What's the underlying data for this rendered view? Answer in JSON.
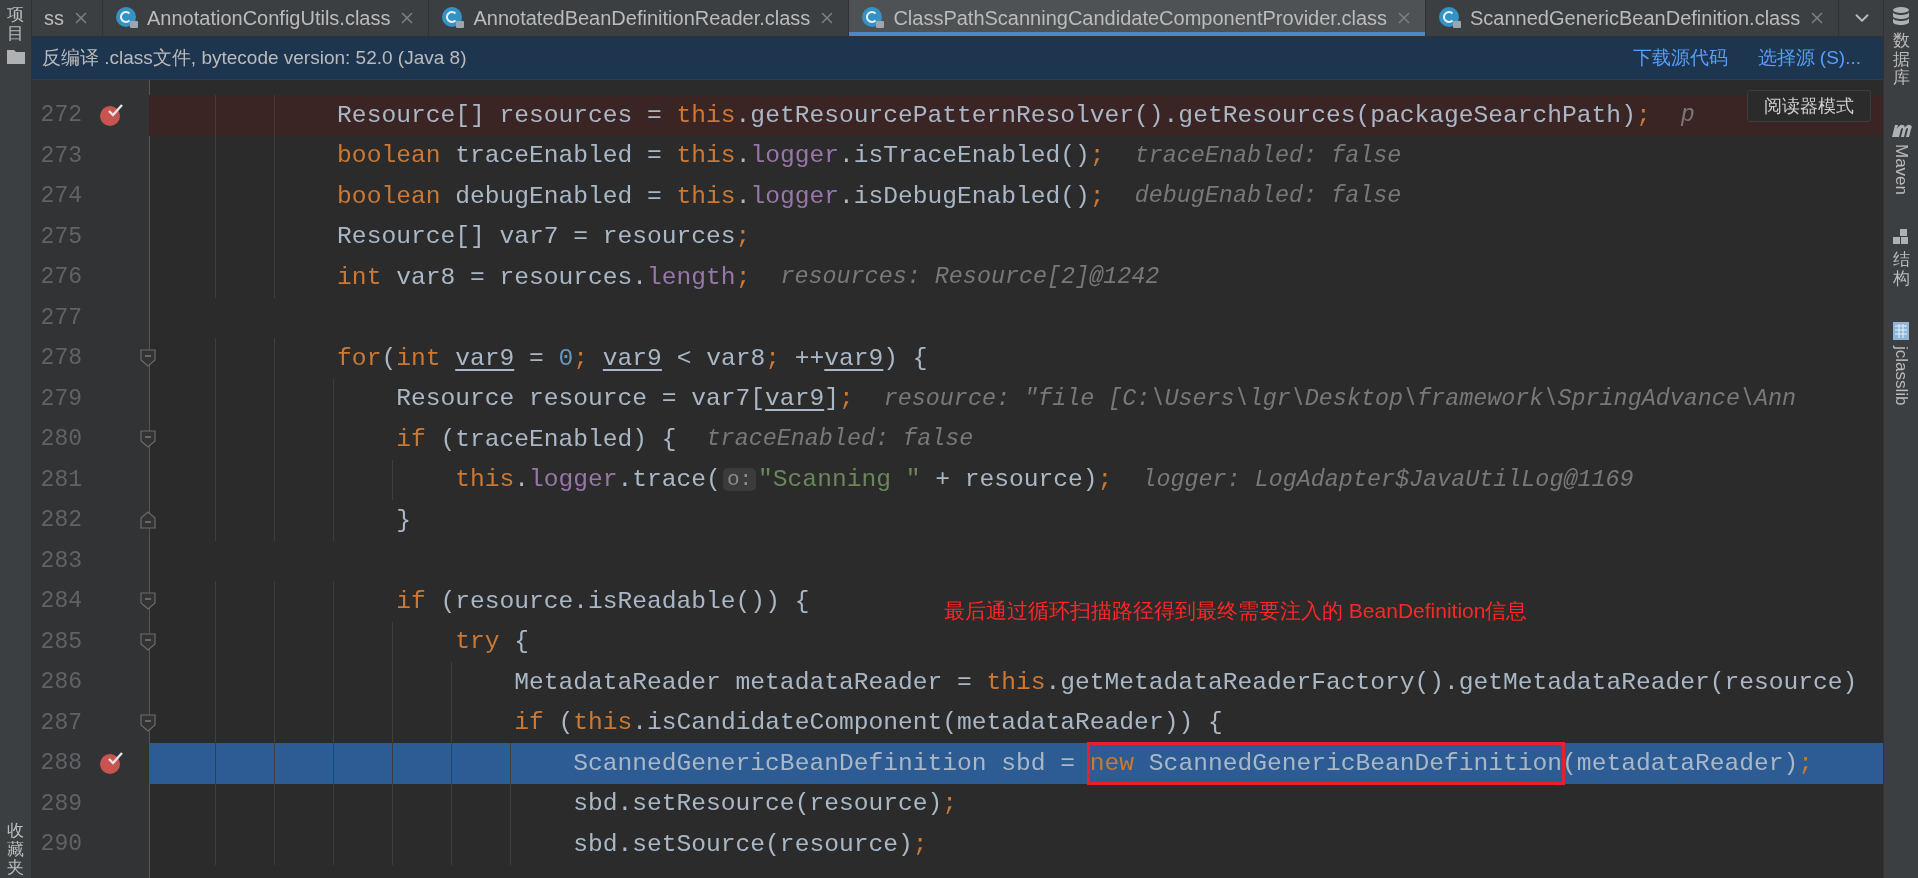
{
  "left_strip": {
    "top_label": "项目",
    "bottom_label": "收藏夹"
  },
  "tabs": [
    {
      "label": "ss",
      "icon": false,
      "selected": false
    },
    {
      "label": "AnnotationConfigUtils.class",
      "icon": true,
      "selected": false
    },
    {
      "label": "AnnotatedBeanDefinitionReader.class",
      "icon": true,
      "selected": false
    },
    {
      "label": "ClassPathScanningCandidateComponentProvider.class",
      "icon": true,
      "selected": true
    },
    {
      "label": "ScannedGenericBeanDefinition.class",
      "icon": true,
      "selected": false
    }
  ],
  "info_bar": {
    "message": "反编译 .class文件, bytecode version: 52.0 (Java 8)",
    "links": [
      "下载源代码",
      "选择源 (S)..."
    ]
  },
  "reader_mode_button": "阅读器模式",
  "lines": [
    {
      "number": "272",
      "breakpoint": true,
      "current": false,
      "tokens": [
        {
          "text": "            Resource[] resources = ",
          "kind": "plain"
        },
        {
          "text": "this",
          "kind": "kw"
        },
        {
          "text": ".getResourcePatternResolver().getResources(packageSearchPath)",
          "kind": "plain"
        },
        {
          "text": ";",
          "kind": "punct"
        }
      ],
      "hint": "p"
    },
    {
      "number": "273",
      "breakpoint": false,
      "current": false,
      "tokens": [
        {
          "text": "            boolean",
          "kind": "kw"
        },
        {
          "text": " traceEnabled = ",
          "kind": "plain"
        },
        {
          "text": "this",
          "kind": "kw"
        },
        {
          "text": ".",
          "kind": "plain"
        },
        {
          "text": "logger",
          "kind": "field"
        },
        {
          "text": ".isTraceEnabled()",
          "kind": "plain"
        },
        {
          "text": ";",
          "kind": "punct"
        }
      ],
      "hint": "traceEnabled: false"
    },
    {
      "number": "274",
      "breakpoint": false,
      "current": false,
      "tokens": [
        {
          "text": "            boolean",
          "kind": "kw"
        },
        {
          "text": " debugEnabled = ",
          "kind": "plain"
        },
        {
          "text": "this",
          "kind": "kw"
        },
        {
          "text": ".",
          "kind": "plain"
        },
        {
          "text": "logger",
          "kind": "field"
        },
        {
          "text": ".isDebugEnabled()",
          "kind": "plain"
        },
        {
          "text": ";",
          "kind": "punct"
        }
      ],
      "hint": "debugEnabled: false"
    },
    {
      "number": "275",
      "breakpoint": false,
      "current": false,
      "tokens": [
        {
          "text": "            Resource[] var7 = resources",
          "kind": "plain"
        },
        {
          "text": ";",
          "kind": "punct"
        }
      ]
    },
    {
      "number": "276",
      "breakpoint": false,
      "current": false,
      "tokens": [
        {
          "text": "            int",
          "kind": "kw"
        },
        {
          "text": " var8 = resources.",
          "kind": "plain"
        },
        {
          "text": "length",
          "kind": "field"
        },
        {
          "text": ";",
          "kind": "punct"
        }
      ],
      "hint": "resources: Resource[2]@1242"
    },
    {
      "number": "277",
      "breakpoint": false,
      "current": false
    },
    {
      "number": "278",
      "breakpoint": false,
      "current": false,
      "fold_open": true,
      "tokens": [
        {
          "text": "            for",
          "kind": "kw"
        },
        {
          "text": "(",
          "kind": "plain"
        },
        {
          "text": "int",
          "kind": "kw"
        },
        {
          "text": " var9",
          "kind": "var"
        },
        {
          "text": " = ",
          "kind": "plain"
        },
        {
          "text": "0",
          "kind": "num"
        },
        {
          "text": ";",
          "kind": "punct"
        },
        {
          "text": " var9",
          "kind": "var"
        },
        {
          "text": " < var8",
          "kind": "plain"
        },
        {
          "text": ";",
          "kind": "punct"
        },
        {
          "text": " ++",
          "kind": "plain"
        },
        {
          "text": "var9",
          "kind": "var"
        },
        {
          "text": ") {",
          "kind": "plain"
        }
      ]
    },
    {
      "number": "279",
      "breakpoint": false,
      "current": false,
      "tokens": [
        {
          "text": "                Resource resource = var7[",
          "kind": "plain"
        },
        {
          "text": "var9",
          "kind": "var"
        },
        {
          "text": "]",
          "kind": "plain"
        },
        {
          "text": ";",
          "kind": "punct"
        }
      ],
      "hint": "resource: \"file [C:\\Users\\lgr\\Desktop\\framework\\SpringAdvance\\Ann"
    },
    {
      "number": "280",
      "breakpoint": false,
      "current": false,
      "fold_open": true,
      "tokens": [
        {
          "text": "                if",
          "kind": "kw"
        },
        {
          "text": " (traceEnabled) {",
          "kind": "plain"
        }
      ],
      "hint": "traceEnabled: false"
    },
    {
      "number": "281",
      "breakpoint": false,
      "current": false,
      "tokens": [
        {
          "text": "                    this",
          "kind": "kw"
        },
        {
          "text": ".",
          "kind": "plain"
        },
        {
          "text": "logger",
          "kind": "field"
        },
        {
          "text": ".trace(",
          "kind": "plain"
        },
        {
          "text": "o:",
          "kind": "param"
        },
        {
          "text": "\"Scanning \"",
          "kind": "str"
        },
        {
          "text": " + resource)",
          "kind": "plain"
        },
        {
          "text": ";",
          "kind": "punct"
        }
      ],
      "hint": "logger: LogAdapter$JavaUtilLog@1169"
    },
    {
      "number": "282",
      "breakpoint": false,
      "current": false,
      "fold_close": true,
      "tokens": [
        {
          "text": "                }",
          "kind": "plain"
        }
      ]
    },
    {
      "number": "283",
      "breakpoint": false,
      "current": false
    },
    {
      "number": "284",
      "breakpoint": false,
      "current": false,
      "fold_open": true,
      "tokens": [
        {
          "text": "                if",
          "kind": "kw"
        },
        {
          "text": " (resource.isReadable()) {",
          "kind": "plain"
        }
      ]
    },
    {
      "number": "285",
      "breakpoint": false,
      "current": false,
      "fold_open": true,
      "tokens": [
        {
          "text": "                    try",
          "kind": "kw"
        },
        {
          "text": " {",
          "kind": "plain"
        }
      ]
    },
    {
      "number": "286",
      "breakpoint": false,
      "current": false,
      "tokens": [
        {
          "text": "                        MetadataReader metadataReader = ",
          "kind": "plain"
        },
        {
          "text": "this",
          "kind": "kw"
        },
        {
          "text": ".getMetadataReaderFactory().getMetadataReader(resource)",
          "kind": "plain"
        }
      ]
    },
    {
      "number": "287",
      "breakpoint": false,
      "current": false,
      "fold_open": true,
      "tokens": [
        {
          "text": "                        if",
          "kind": "kw"
        },
        {
          "text": " (",
          "kind": "plain"
        },
        {
          "text": "this",
          "kind": "kw"
        },
        {
          "text": ".isCandidateComponent(metadataReader)) {",
          "kind": "plain"
        }
      ]
    },
    {
      "number": "288",
      "breakpoint": true,
      "current": true,
      "tokens": [
        {
          "text": "                            ScannedGenericBeanDefinition sbd = ",
          "kind": "plain"
        },
        {
          "text": "new",
          "kind": "kw",
          "boxed": true
        },
        {
          "text": " ScannedGenericBeanDefinition",
          "kind": "plain",
          "boxed": true
        },
        {
          "text": "(metadataReader)",
          "kind": "plain"
        },
        {
          "text": ";",
          "kind": "punct"
        }
      ]
    },
    {
      "number": "289",
      "breakpoint": false,
      "current": false,
      "tokens": [
        {
          "text": "                            sbd.setResource(resource)",
          "kind": "plain"
        },
        {
          "text": ";",
          "kind": "punct"
        }
      ]
    },
    {
      "number": "290",
      "breakpoint": false,
      "current": false,
      "tokens": [
        {
          "text": "                            sbd.setSource(resource)",
          "kind": "plain"
        },
        {
          "text": ";",
          "kind": "punct"
        }
      ]
    }
  ],
  "annotation": {
    "text": "最后通过循环扫描路径得到最终需要注入的 BeanDefinition信息"
  },
  "right_strip": [
    {
      "kind": "database",
      "label": "数据库"
    },
    {
      "kind": "maven",
      "label": "Maven"
    },
    {
      "kind": "structure",
      "label": "结构"
    },
    {
      "kind": "jclasslib",
      "label": "jclasslib"
    }
  ]
}
